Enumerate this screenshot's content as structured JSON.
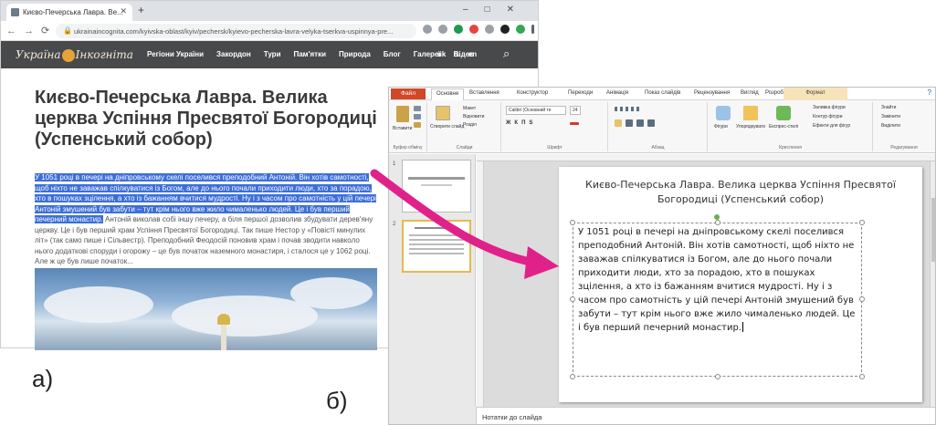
{
  "labels": {
    "a": "а)",
    "b": "б)"
  },
  "browser": {
    "tab_title": "Києво-Печерська Лавра. Ве...",
    "url": "ukrainaincognita.com/kyivska-oblast/kyiv/pechersk/kyievo-pecherska-lavra-velyka-tserkva-uspinnya-pre...",
    "logo_left": "Україна",
    "logo_right": "Інкогніта",
    "nav": [
      "Регіони України",
      "Закордон",
      "Тури",
      "Пам'ятки",
      "Природа",
      "Блог",
      "Галереї",
      "Відео"
    ],
    "langs": "uk ru en",
    "heading": "Києво-Печерська Лавра. Велика церква Успіння Пресвятої Богородиці (Успенський собор)",
    "para_selected": "У 1051 році в печері на дніпровському скелі поселився преподобний Антоній. Він хотів самотності, щоб ніхто не заважав спілкуватися із Богом, але до нього почали приходити люди, хто за порадою, хто в пошуках зцілення, а хто із бажанням вчитися мудрості. Ну і з часом про самотність у цій печері Антоній змушений був забути – тут крім нього вже жило чималенько людей. Це і був перший печерний монастир.",
    "para_rest": " Антоній виколав собі іншу печеру, а біля першої дозволив збудувати дерев'яну церкву. Це і був перший храм Успіння Пресвятої Богородиці. Так пише Нестор у «Повісті минулих літ» (так само пише і Сільвестр). Преподобний Феодосій поновив храм і почав зводити навколо нього додаткові споруди і огорожу – це був початок наземного монастиря, і сталося це у 1062 році. Але ж це був лише початок..."
  },
  "ppt": {
    "file_tab": "Файл",
    "tabs": [
      "Основне",
      "Вставлення",
      "Конструктор",
      "Переходи",
      "Анімація",
      "Показ слайдів",
      "Рецензування",
      "Вигляд",
      "Розробник"
    ],
    "format_tab": "Формат",
    "groups": [
      "Буфер обміну",
      "Слайди",
      "Шрифт",
      "Абзац",
      "Креслення",
      "Редагування"
    ],
    "ribbon_texts": {
      "paste": "Вставити",
      "new_slide": "Створити слайд",
      "layout": "Макет",
      "reset": "Відновити",
      "section": "Розділ",
      "font_name": "Calibri (Основний те",
      "font_size": "24",
      "shapes": "Фігури",
      "arrange": "Упорядкувати",
      "quick_styles": "Експрес-стилі",
      "fill": "Заливка фігури",
      "outline": "Контур фігури",
      "effects": "Ефекти для фігур",
      "find": "Знайти",
      "replace": "Замінити",
      "select": "Виділити"
    },
    "slide_title": "Києво-Печерська Лавра. Велика церква Успіння Пресвятої Богородиці (Успенський собор)",
    "slide_body": "У 1051 році в печері на дніпровському скелі поселився преподобний Антоній. Він хотів самотності, щоб ніхто не заважав спілкуватися із Богом, але до нього почали приходити люди, хто за порадою, хто в пошуках зцілення, а хто із бажанням вчитися мудрості. Ну і з часом про самотність у цій печері Антоній змушений був забути – тут крім нього вже жило чималенько людей. Це і був перший печерний монастир.",
    "thumb_numbers": [
      "1",
      "2"
    ],
    "notes": "Нотатки до слайда"
  },
  "colors": {
    "arrow": "#e0218a",
    "selection": "#3c6fd8",
    "file_tab": "#d24726"
  }
}
